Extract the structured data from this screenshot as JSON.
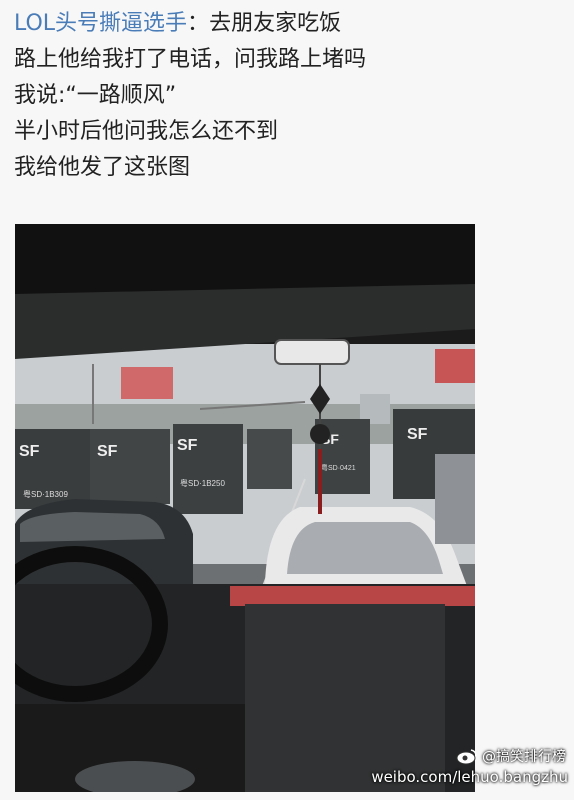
{
  "post": {
    "username": "LOL头号撕逼选手",
    "separator": "：",
    "lines": [
      "去朋友家吃饭",
      "路上他给我打了电话，问我路上堵吗",
      "我说:“一路顺风”",
      "半小时后他问我怎么还不到",
      "我给他发了这张图"
    ]
  },
  "photo": {
    "billboard_sign_text": "SF",
    "truck_logo_text": "SF",
    "truck_plate_1": "粤SD·1B309",
    "truck_plate_2": "粤SD·1B250",
    "truck_plate_3": "粤SD·0421"
  },
  "watermark": {
    "handle": "@搞笑排行榜",
    "site": "weibo.com/lehuo.bangzhu"
  },
  "colors": {
    "username": "#4a7cb8",
    "text": "#222222",
    "background": "#f7f7f7"
  }
}
